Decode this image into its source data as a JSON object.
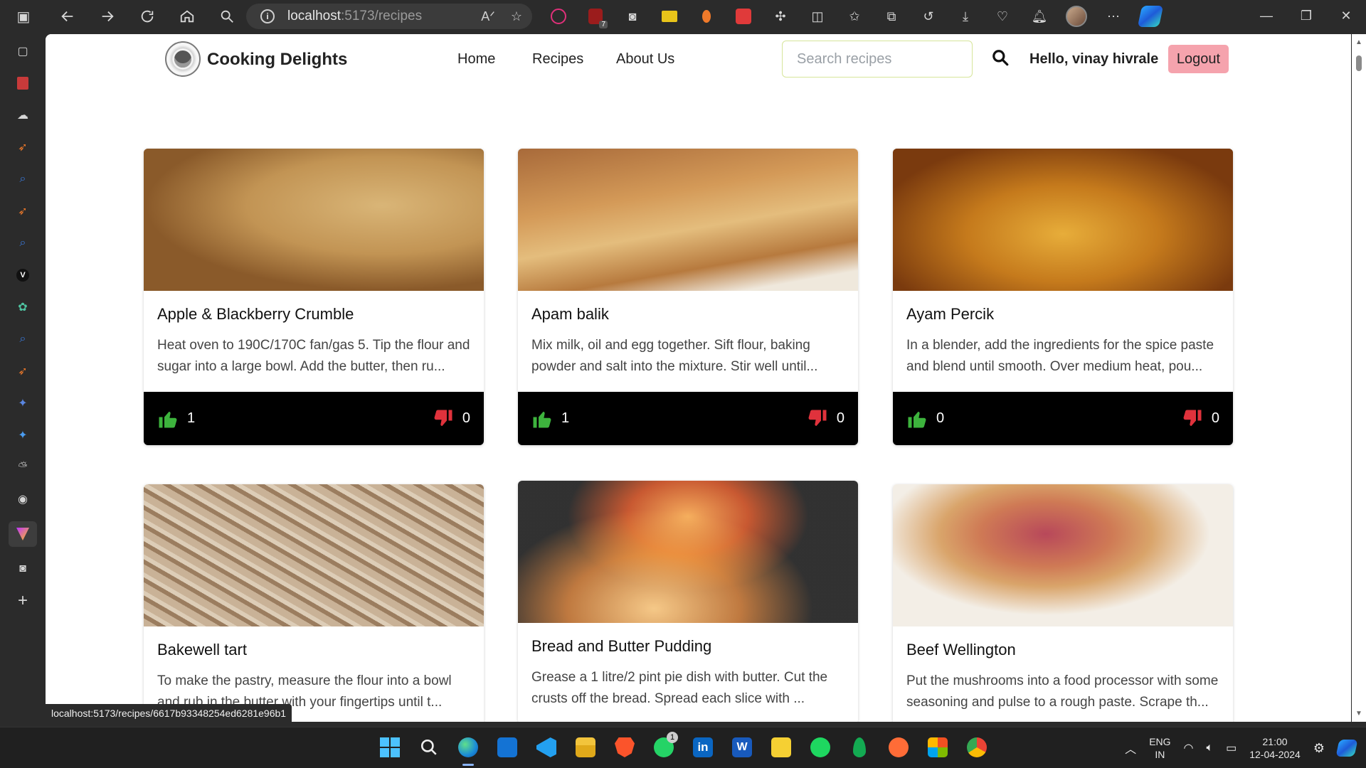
{
  "browser": {
    "url_host": "localhost",
    "url_path": ":5173/recipes",
    "status_url": "localhost:5173/recipes/6617b93348254ed6281e96b1",
    "extension_badges": {
      "ublock_count": "7"
    }
  },
  "app": {
    "brand": "Cooking Delights",
    "nav": [
      "Home",
      "Recipes",
      "About Us"
    ],
    "search_placeholder": "Search recipes",
    "greeting": "Hello, vinay hivrale",
    "logout_label": "Logout"
  },
  "recipes": [
    {
      "title": "Apple & Blackberry Crumble",
      "description": "Heat oven to 190C/170C fan/gas 5. Tip the flour and sugar into a large bowl. Add the butter, then ru...",
      "likes": "1",
      "dislikes": "0",
      "image_colors": [
        "#c9a76a",
        "#b07a3c",
        "#8c2c3a"
      ]
    },
    {
      "title": "Apam balik",
      "description": "Mix milk, oil and egg together. Sift flour, baking powder and salt into the mixture. Stir well until...",
      "likes": "1",
      "dislikes": "0",
      "image_colors": [
        "#c98a48",
        "#e1b674",
        "#7a4a28"
      ]
    },
    {
      "title": "Ayam Percik",
      "description": "In a blender, add the ingredients for the spice paste and blend until smooth. Over medium heat, pou...",
      "likes": "0",
      "dislikes": "0",
      "image_colors": [
        "#d69a2e",
        "#a35a12",
        "#5e2a0c"
      ]
    },
    {
      "title": "Bakewell tart",
      "description": "To make the pastry, measure the flour into a bowl and rub in the butter with your fingertips until t...",
      "likes": "",
      "dislikes": "",
      "image_colors": [
        "#b9a388",
        "#8c7058",
        "#d8c9b4"
      ]
    },
    {
      "title": "Bread and Butter Pudding",
      "description": "Grease a 1 litre/2 pint pie dish with butter. Cut the crusts off the bread. Spread each slice with ...",
      "likes": "",
      "dislikes": "",
      "image_colors": [
        "#1a1a1a",
        "#d8601c",
        "#f4c27a"
      ]
    },
    {
      "title": "Beef Wellington",
      "description": "Put the mushrooms into a food processor with some seasoning and pulse to a rough paste. Scrape th...",
      "likes": "",
      "dislikes": "",
      "image_colors": [
        "#f3eee6",
        "#cf7a55",
        "#b8485a"
      ]
    }
  ],
  "taskbar": {
    "whatsapp_badge": "1",
    "lang_line1": "ENG",
    "lang_line2": "IN",
    "time": "21:00",
    "date": "12-04-2024"
  },
  "colors": {
    "logout_bg": "#f5a3ad",
    "like": "#3db33d",
    "dislike": "#e0323c",
    "card_footer": "#000000",
    "search_border": "#d6e59a"
  }
}
